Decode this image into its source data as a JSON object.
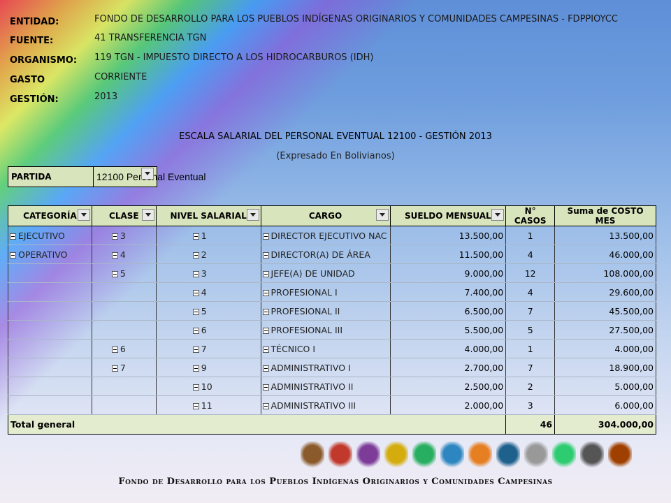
{
  "header": {
    "entidad_label": "ENTIDAD:",
    "entidad_value": "FONDO DE DESARROLLO PARA LOS PUEBLOS INDÍGENAS ORIGINARIOS Y COMUNIDADES CAMPESINAS - FDPPIOYCC",
    "fuente_label": "FUENTE:",
    "fuente_value": "41 TRANSFERENCIA TGN",
    "organismo_label": "ORGANISMO:",
    "organismo_value": "119 TGN - IMPUESTO DIRECTO A LOS HIDROCARBUROS (IDH)",
    "gasto_label": "GASTO",
    "gasto_value": "CORRIENTE",
    "gestion_label": "GESTIÓN:",
    "gestion_value": "2013"
  },
  "title": "ESCALA SALARIAL DEL PERSONAL EVENTUAL 12100 - GESTIÓN 2013",
  "subtitle": "(Expresado En Bolivianos)",
  "partida": {
    "label": "PARTIDA",
    "value": "12100 Personal Eventual"
  },
  "columns": [
    "CATEGORÍA",
    "CLASE",
    "NIVEL SALARIAL",
    "CARGO",
    "SUELDO MENSUAL",
    "N° CASOS",
    "Suma de COSTO MES"
  ],
  "rows": [
    {
      "categoria": "EJECUTIVO",
      "clase": "3",
      "nivel": "1",
      "cargo": "DIRECTOR EJECUTIVO NAC",
      "sueldo": "13.500,00",
      "casos": "1",
      "costo": "13.500,00"
    },
    {
      "categoria": "OPERATIVO",
      "clase": "4",
      "nivel": "2",
      "cargo": "DIRECTOR(A) DE ÁREA",
      "sueldo": "11.500,00",
      "casos": "4",
      "costo": "46.000,00"
    },
    {
      "categoria": "",
      "clase": "5",
      "nivel": "3",
      "cargo": "JEFE(A) DE UNIDAD",
      "sueldo": "9.000,00",
      "casos": "12",
      "costo": "108.000,00"
    },
    {
      "categoria": "",
      "clase": "",
      "nivel": "4",
      "cargo": "PROFESIONAL I",
      "sueldo": "7.400,00",
      "casos": "4",
      "costo": "29.600,00"
    },
    {
      "categoria": "",
      "clase": "",
      "nivel": "5",
      "cargo": "PROFESIONAL II",
      "sueldo": "6.500,00",
      "casos": "7",
      "costo": "45.500,00"
    },
    {
      "categoria": "",
      "clase": "",
      "nivel": "6",
      "cargo": "PROFESIONAL III",
      "sueldo": "5.500,00",
      "casos": "5",
      "costo": "27.500,00"
    },
    {
      "categoria": "",
      "clase": "6",
      "nivel": "7",
      "cargo": "TÉCNICO I",
      "sueldo": "4.000,00",
      "casos": "1",
      "costo": "4.000,00"
    },
    {
      "categoria": "",
      "clase": "7",
      "nivel": "9",
      "cargo": "ADMINISTRATIVO I",
      "sueldo": "2.700,00",
      "casos": "7",
      "costo": "18.900,00"
    },
    {
      "categoria": "",
      "clase": "",
      "nivel": "10",
      "cargo": "ADMINISTRATIVO II",
      "sueldo": "2.500,00",
      "casos": "2",
      "costo": "5.000,00"
    },
    {
      "categoria": "",
      "clase": "",
      "nivel": "11",
      "cargo": "ADMINISTRATIVO III",
      "sueldo": "2.000,00",
      "casos": "3",
      "costo": "6.000,00"
    }
  ],
  "total": {
    "label": "Total general",
    "casos": "46",
    "costo": "304.000,00"
  },
  "footer": "Fondo de Desarrollo para los Pueblos Indígenas Originarios y Comunidades Campesinas",
  "logos": [
    "indigenous-woman-icon",
    "bolivia-map-icon",
    "wiphala-icon",
    "seal-icon",
    "map-icon",
    "mountain-icon",
    "wiphala-flag-icon",
    "apg-logo-icon",
    "diamond-icon",
    "house-icon",
    "bow-icon",
    "pottery-icon"
  ],
  "colors": {
    "header_fill": "#d8e4bc",
    "accent": "#5e8fd8"
  }
}
